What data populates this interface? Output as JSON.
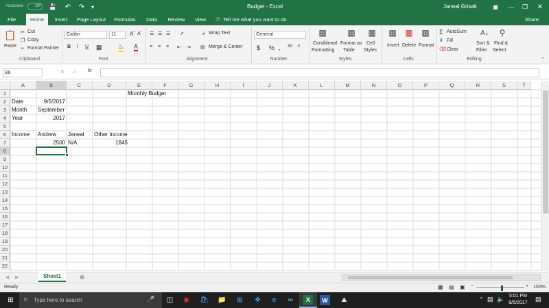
{
  "titlebar": {
    "autosave": "AutoSave",
    "autosave_state": "Off",
    "title": "Budget  -  Excel",
    "user": "Janeal Grisak"
  },
  "tabs": [
    "File",
    "Home",
    "Insert",
    "Page Layout",
    "Formulas",
    "Data",
    "Review",
    "View"
  ],
  "tell_me": "Tell me what you want to do",
  "share": "Share",
  "ribbon": {
    "paste": "Paste",
    "cut": "Cut",
    "copy": "Copy",
    "format_painter": "Format Painter",
    "clipboard": "Clipboard",
    "font_name": "Calibri",
    "font_size": "11",
    "font_label": "Font",
    "wrap_text": "Wrap Text",
    "merge_center": "Merge & Center",
    "alignment": "Alignment",
    "number_format": "General",
    "number": "Number",
    "conditional": "Conditional",
    "formatting": "Formatting",
    "format_as": "Format as",
    "table": "Table",
    "cell": "Cell",
    "styles_btn": "Styles",
    "styles": "Styles",
    "insert": "Insert",
    "delete": "Delete",
    "format": "Format",
    "cells": "Cells",
    "autosum": "AutoSum",
    "fill": "Fill",
    "clear": "Clear",
    "sort_filter": "Sort &",
    "filter": "Filter",
    "find_select": "Find &",
    "select": "Select",
    "editing": "Editing"
  },
  "name_box": "B8",
  "formula_fx": "fx",
  "columns": [
    "A",
    "B",
    "C",
    "D",
    "E",
    "F",
    "G",
    "H",
    "I",
    "J",
    "K",
    "L",
    "M",
    "N",
    "O",
    "P",
    "Q",
    "R",
    "S",
    "T"
  ],
  "rows": [
    "1",
    "2",
    "3",
    "4",
    "5",
    "6",
    "7",
    "8",
    "9",
    "10",
    "11",
    "12",
    "13",
    "14",
    "15",
    "16",
    "17",
    "18",
    "19",
    "20",
    "21",
    "22"
  ],
  "cells": {
    "d1": "Monthly Budget",
    "a2": "Date",
    "b2": "9/5/2017",
    "a3": "Month",
    "b3": "September",
    "a4": "Year",
    "b4": "2017",
    "a6": "Income",
    "b6": "Andrew",
    "c6": "Janeal",
    "d6": "Other Income",
    "b7": "2500",
    "c7": "N/A",
    "d7": "1845"
  },
  "sheet_tab": "Sheet1",
  "status": "Ready",
  "zoom": "100%",
  "taskbar": {
    "search": "Type here to search",
    "time": "5:01 PM",
    "date": "9/5/2017"
  },
  "colors": {
    "excel_green": "#217346",
    "taskbar": "#1f1f1f"
  }
}
